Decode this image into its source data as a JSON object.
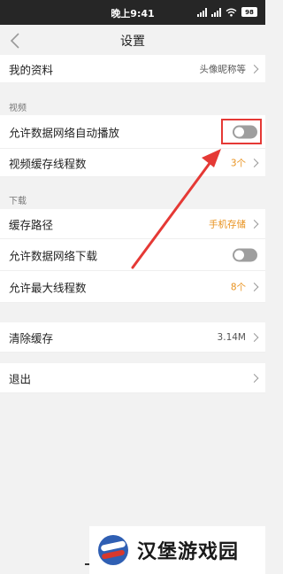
{
  "status_bar": {
    "time": "晚上9:41",
    "battery": "98"
  },
  "nav": {
    "title": "设置"
  },
  "profile": {
    "label": "我的资料",
    "value": "头像昵称等"
  },
  "video_section": {
    "header": "视频",
    "items": [
      {
        "label": "允许数据网络自动播放",
        "toggle_on": false
      },
      {
        "label": "视频缓存线程数",
        "value": "3个"
      }
    ]
  },
  "download_section": {
    "header": "下载",
    "items": [
      {
        "label": "缓存路径",
        "value": "手机存储"
      },
      {
        "label": "允许数据网络下载",
        "toggle_on": false
      },
      {
        "label": "允许最大线程数",
        "value": "8个"
      }
    ]
  },
  "cache": {
    "label": "清除缓存",
    "value": "3.14M"
  },
  "logout": {
    "label": "退出"
  },
  "watermark": {
    "text": "汉堡游戏园"
  },
  "colors": {
    "accent": "#e8911d",
    "annotation": "#e53935",
    "toggle_off": "#9e9e9e"
  }
}
